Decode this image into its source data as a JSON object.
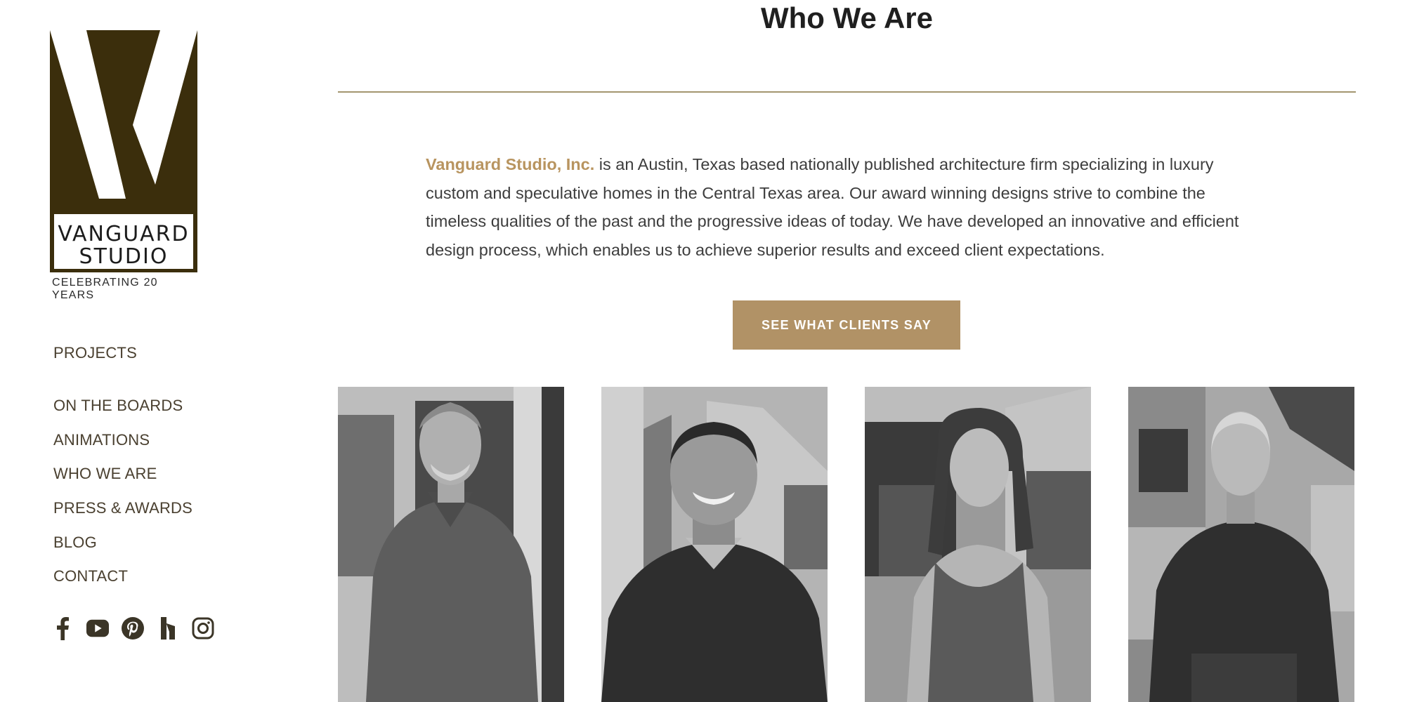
{
  "brand": {
    "logo_line1": "VANGUARD",
    "logo_line2": "STUDIO",
    "tagline": "CELEBRATING 20 YEARS",
    "logo_color": "#3b2e0c"
  },
  "nav": {
    "items": [
      {
        "label": "PROJECTS"
      },
      {
        "label": "ON THE BOARDS"
      },
      {
        "label": "ANIMATIONS"
      },
      {
        "label": "WHO WE ARE"
      },
      {
        "label": "PRESS & AWARDS"
      },
      {
        "label": "BLOG"
      },
      {
        "label": "CONTACT"
      }
    ]
  },
  "social": {
    "icons": [
      "facebook-icon",
      "youtube-icon",
      "pinterest-icon",
      "houzz-icon",
      "instagram-icon"
    ]
  },
  "main": {
    "title": "Who We Are",
    "intro_brand": "Vanguard Studio, Inc.",
    "intro_text": " is an Austin, Texas based nationally published architecture firm specializing in luxury custom and speculative homes in the Central Texas area. Our award winning designs strive to combine the timeless qualities of the past and the progressive ideas of today. We have developed an innovative and efficient design process, which enables us to achieve superior results and exceed client expectations.",
    "cta_label": "SEE WHAT CLIENTS SAY"
  },
  "colors": {
    "accent": "#b19266",
    "brand_link": "#b8945f",
    "divider": "#a39670",
    "nav_text": "#4a4030"
  }
}
